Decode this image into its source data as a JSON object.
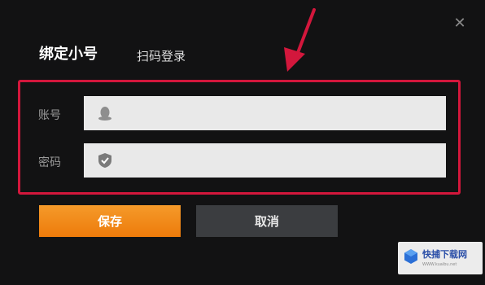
{
  "dialog": {
    "close_icon": "close-icon",
    "tabs": [
      {
        "label": "绑定小号",
        "active": true
      },
      {
        "label": "扫码登录",
        "active": false
      }
    ]
  },
  "form": {
    "account": {
      "label": "账号",
      "icon": "qq-penguin-icon",
      "value": ""
    },
    "password": {
      "label": "密码",
      "icon": "shield-icon",
      "value": ""
    }
  },
  "buttons": {
    "save_label": "保存",
    "cancel_label": "取消"
  },
  "annotation": {
    "highlight_color": "#d3173c",
    "arrow_color": "#d3173c"
  },
  "watermark": {
    "text": "快捕下载网",
    "subtext": "WWW.kuaibu.net"
  },
  "colors": {
    "accent": "#ed7b0b",
    "background": "#121213"
  }
}
